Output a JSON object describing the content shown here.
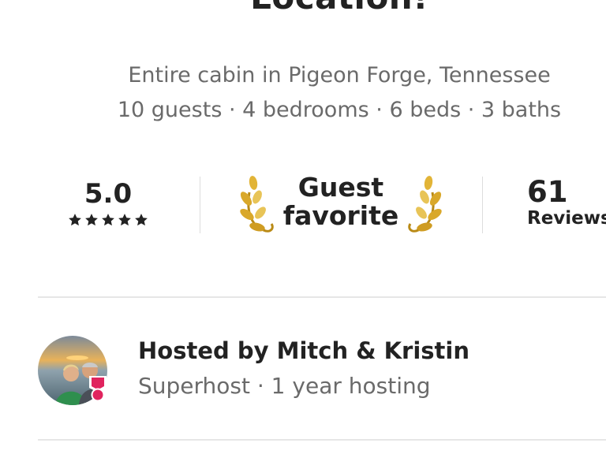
{
  "listing": {
    "title": "Location!",
    "property_line": "Entire cabin in Pigeon Forge, Tennessee",
    "details_line": "10 guests · 4 bedrooms · 6 beds · 3 baths"
  },
  "stats": {
    "rating": "5.0",
    "stars": 5,
    "guest_favorite": {
      "line1": "Guest",
      "line2": "favorite"
    },
    "reviews_count": "61",
    "reviews_label": "Reviews"
  },
  "host": {
    "name_line": "Hosted by Mitch & Kristin",
    "sub_line": "Superhost · 1 year hosting"
  },
  "colors": {
    "text_primary": "#222222",
    "text_secondary": "#6a6a6a",
    "divider": "#dddddd",
    "laurel_gold": "#d9a82a",
    "superhost_badge": "#e0245e"
  }
}
